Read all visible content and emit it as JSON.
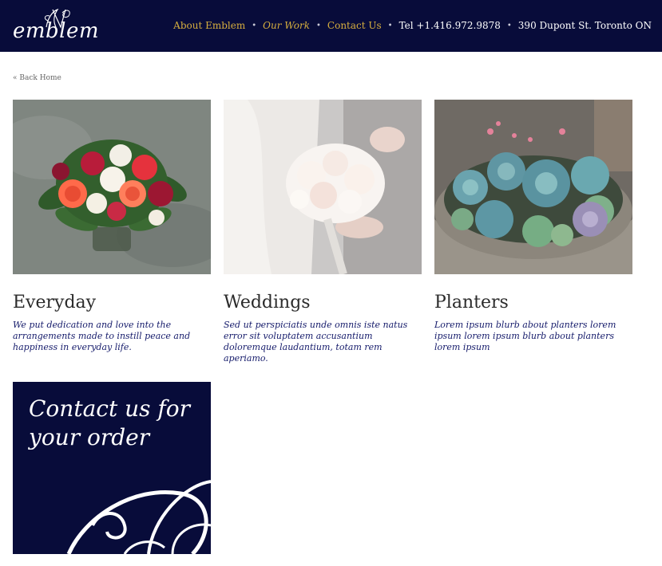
{
  "header": {
    "logo_text": "emblem",
    "nav": {
      "about": "About Emblem",
      "work": "Our Work",
      "contact": "Contact Us",
      "phone": "Tel +1.416.972.9878",
      "address": "390 Dupont St. Toronto ON",
      "separator": "•"
    }
  },
  "back_link": "« Back Home",
  "cards": [
    {
      "title": "Everyday",
      "description": "We put dedication and love into the arrangements made to instill peace and happiness in everyday life."
    },
    {
      "title": "Weddings",
      "description": "Sed ut perspiciatis unde omnis iste natus error sit voluptatem accusantium doloremque laudantium, totam rem aperiamo."
    },
    {
      "title": "Planters",
      "description": "Lorem ipsum blurb about planters lorem ipsum lorem ipsum blurb about planters lorem ipsum"
    }
  ],
  "promo": {
    "line1": "Contact us for",
    "line2": "your order"
  },
  "colors": {
    "navy": "#080c3a",
    "gold": "#d6ae3f",
    "description_blue": "#141a6a"
  }
}
